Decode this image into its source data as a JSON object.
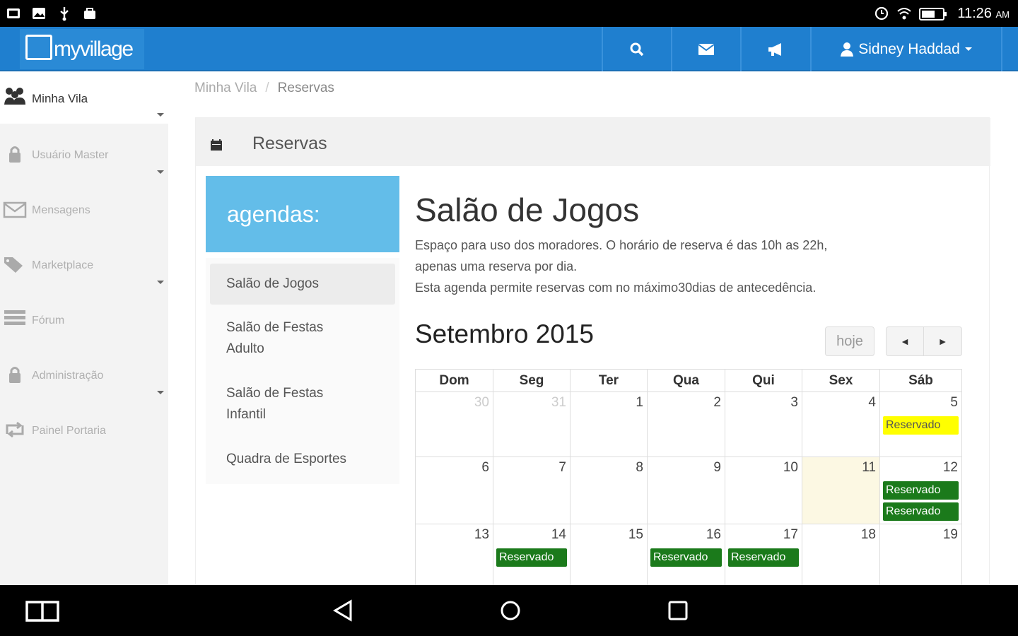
{
  "status_bar": {
    "time": "11:26",
    "ampm": "AM"
  },
  "navbar": {
    "brand": "myvillage",
    "user_name": "Sidney Haddad",
    "icons": [
      "search-icon",
      "envelope-icon",
      "megaphone-icon",
      "user-icon"
    ]
  },
  "sidebar": {
    "items": [
      {
        "label": "Minha Vila",
        "icon": "users-icon",
        "caret": true
      },
      {
        "label": "Usuário Master",
        "icon": "lock-icon",
        "caret": true
      },
      {
        "label": "Mensagens",
        "icon": "envelope-icon",
        "caret": false
      },
      {
        "label": "Marketplace",
        "icon": "tags-icon",
        "caret": true
      },
      {
        "label": "Fórum",
        "icon": "list-icon",
        "caret": false
      },
      {
        "label": "Administração",
        "icon": "lock-icon",
        "caret": true
      },
      {
        "label": "Painel Portaria",
        "icon": "retweet-icon",
        "caret": false
      }
    ]
  },
  "breadcrumb": {
    "root": "Minha Vila",
    "separator": "/",
    "current": "Reservas"
  },
  "panel": {
    "title": "Reservas",
    "icon": "calendar-icon"
  },
  "agendas": {
    "header": "agendas:",
    "items": [
      {
        "label": "Salão de Jogos",
        "selected": true
      },
      {
        "label": "Salão de Festas Adulto",
        "selected": false
      },
      {
        "label": "Salão de Festas Infantil",
        "selected": false
      },
      {
        "label": "Quadra de Esportes",
        "selected": false
      }
    ]
  },
  "main": {
    "title": "Salão de Jogos",
    "desc_line1": "Espaço para uso dos moradores. O horário de reserva é das 10h as 22h,",
    "desc_line2": "apenas uma reserva por dia.",
    "desc_line3": "Esta agenda permite reservas com no máximo30dias de antecedência."
  },
  "calendar": {
    "month_label": "Setembro 2015",
    "today_label": "hoje",
    "prev_label": "◄",
    "next_label": "►",
    "weekdays": [
      "Dom",
      "Seg",
      "Ter",
      "Qua",
      "Qui",
      "Sex",
      "Sáb"
    ],
    "weeks": [
      [
        {
          "d": "30",
          "other": true
        },
        {
          "d": "31",
          "other": true
        },
        {
          "d": "1"
        },
        {
          "d": "2"
        },
        {
          "d": "3"
        },
        {
          "d": "4"
        },
        {
          "d": "5",
          "events": [
            {
              "label": "Reservado",
              "status": "pending"
            }
          ]
        }
      ],
      [
        {
          "d": "6"
        },
        {
          "d": "7"
        },
        {
          "d": "8"
        },
        {
          "d": "9"
        },
        {
          "d": "10"
        },
        {
          "d": "11",
          "today": true
        },
        {
          "d": "12",
          "events": [
            {
              "label": "Reservado",
              "status": "confirmed"
            },
            {
              "label": "Reservado",
              "status": "confirmed"
            }
          ]
        }
      ],
      [
        {
          "d": "13"
        },
        {
          "d": "14",
          "events": [
            {
              "label": "Reservado",
              "status": "confirmed"
            }
          ]
        },
        {
          "d": "15"
        },
        {
          "d": "16",
          "events": [
            {
              "label": "Reservado",
              "status": "confirmed"
            }
          ]
        },
        {
          "d": "17",
          "events": [
            {
              "label": "Reservado",
              "status": "confirmed"
            }
          ]
        },
        {
          "d": "18"
        },
        {
          "d": "19"
        }
      ]
    ]
  },
  "colors": {
    "navbar": "#1f7fcf",
    "agendas_header": "#63bde9",
    "confirmed": "#1b7a1b",
    "pending": "#ffff00",
    "today": "#fcf8e3"
  }
}
